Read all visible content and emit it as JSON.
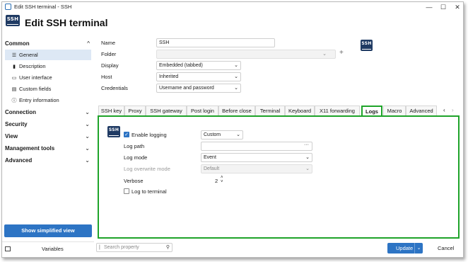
{
  "window": {
    "title": "Edit SSH terminal - SSH",
    "minimize": "—",
    "maximize": "☐",
    "close": "✕"
  },
  "header": {
    "logo_text": "SSH",
    "title": "Edit SSH terminal"
  },
  "sidebar": {
    "common_label": "Common",
    "common_chevron": "^",
    "items": [
      {
        "label": "General",
        "icon": "☰"
      },
      {
        "label": "Description",
        "icon": "▮"
      },
      {
        "label": "User interface",
        "icon": "▭"
      },
      {
        "label": "Custom fields",
        "icon": "▤"
      },
      {
        "label": "Entry information",
        "icon": "ⓘ"
      }
    ],
    "sections": [
      {
        "label": "Connection",
        "chevron": "⌄"
      },
      {
        "label": "Security",
        "chevron": "⌄"
      },
      {
        "label": "View",
        "chevron": "⌄"
      },
      {
        "label": "Management tools",
        "chevron": "⌄"
      },
      {
        "label": "Advanced",
        "chevron": "⌄"
      }
    ],
    "simplified_button": "Show simplified view",
    "variables_label": "Variables"
  },
  "general": {
    "name_label": "Name",
    "name_value": "SSH",
    "folder_label": "Folder",
    "folder_value": "",
    "folder_add": "+",
    "display_label": "Display",
    "display_value": "Embedded (tabbed)",
    "host_label": "Host",
    "host_value": "Inherited",
    "credentials_label": "Credentials",
    "credentials_value": "Username and password",
    "logo_text": "SSH"
  },
  "tabs": [
    "SSH key",
    "Proxy",
    "SSH gateway",
    "Post login",
    "Before close",
    "Terminal",
    "Keyboard",
    "X11 forwarding",
    "Logs",
    "Macro",
    "Advanced"
  ],
  "active_tab": "Logs",
  "tab_scroll": {
    "left": "‹",
    "right": "›"
  },
  "logs": {
    "logo_text": "SSH",
    "enable_logging_label": "Enable logging",
    "enable_logging_checked": true,
    "enable_logging_value": "Custom",
    "log_path_label": "Log path",
    "log_path_value": "",
    "log_path_browse": "···",
    "log_mode_label": "Log mode",
    "log_mode_value": "Event",
    "log_overwrite_label": "Log overwrite mode",
    "log_overwrite_value": "Default",
    "verbose_label": "Verbose",
    "verbose_value": "2",
    "log_to_terminal_label": "Log to terminal",
    "log_to_terminal_checked": false
  },
  "footer": {
    "search_placeholder": "Search property",
    "update_label": "Update",
    "cancel_label": "Cancel"
  },
  "colors": {
    "accent": "#2d74c4",
    "highlight_border": "#1fa32a",
    "logo_bg": "#1f3a63"
  }
}
